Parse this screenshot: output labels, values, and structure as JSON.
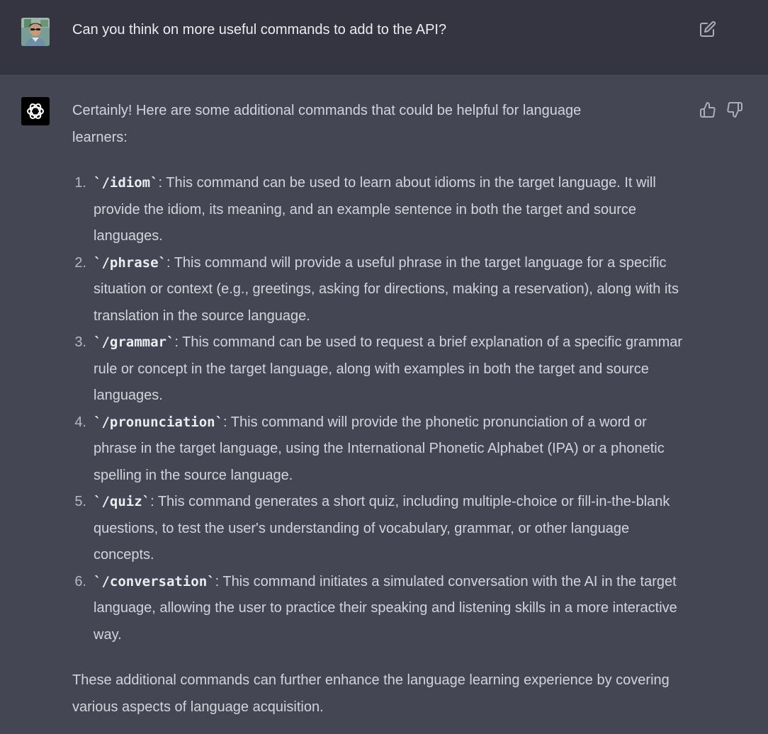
{
  "user_message": {
    "text": "Can you think on more useful commands to add to the API?",
    "avatar_icon": "user-avatar-photo",
    "edit_icon": "edit-icon"
  },
  "assistant_message": {
    "intro": "Certainly! Here are some additional commands that could be helpful for language learners:",
    "commands": [
      {
        "number": "1.",
        "command": "`/idiom`",
        "description": ": This command can be used to learn about idioms in the target language. It will provide the idiom, its meaning, and an example sentence in both the target and source languages."
      },
      {
        "number": "2.",
        "command": "`/phrase`",
        "description": ": This command will provide a useful phrase in the target language for a specific situation or context (e.g., greetings, asking for directions, making a reservation), along with its translation in the source language."
      },
      {
        "number": "3.",
        "command": "`/grammar`",
        "description": ": This command can be used to request a brief explanation of a specific grammar rule or concept in the target language, along with examples in both the target and source languages."
      },
      {
        "number": "4.",
        "command": "`/pronunciation`",
        "description": ": This command will provide the phonetic pronunciation of a word or phrase in the target language, using the International Phonetic Alphabet (IPA) or a phonetic spelling in the source language."
      },
      {
        "number": "5.",
        "command": "`/quiz`",
        "description": ": This command generates a short quiz, including multiple-choice or fill-in-the-blank questions, to test the user's understanding of vocabulary, grammar, or other language concepts."
      },
      {
        "number": "6.",
        "command": "`/conversation`",
        "description": ": This command initiates a simulated conversation with the AI in the target language, allowing the user to practice their speaking and listening skills in a more interactive way."
      }
    ],
    "conclusion": "These additional commands can further enhance the language learning experience by covering various aspects of language acquisition.",
    "avatar_icon": "openai-logo-icon",
    "feedback": {
      "thumbs_up_icon": "thumbs-up-icon",
      "thumbs_down_icon": "thumbs-down-icon"
    }
  },
  "colors": {
    "user_bg": "#343541",
    "assistant_bg": "#444654",
    "text": "#d1d5db"
  }
}
